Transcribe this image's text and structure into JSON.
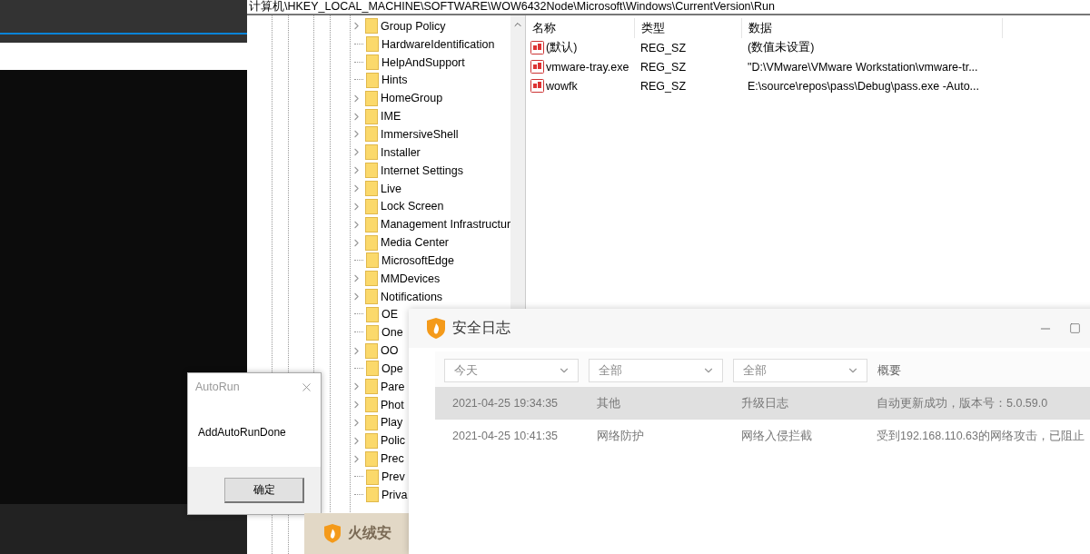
{
  "registry_editor": {
    "address": "计算机\\HKEY_LOCAL_MACHINE\\SOFTWARE\\WOW6432Node\\Microsoft\\Windows\\CurrentVersion\\Run",
    "tree": [
      {
        "label": "Group Policy",
        "has_children": true
      },
      {
        "label": "HardwareIdentification",
        "has_children": false
      },
      {
        "label": "HelpAndSupport",
        "has_children": false
      },
      {
        "label": "Hints",
        "has_children": false
      },
      {
        "label": "HomeGroup",
        "has_children": true
      },
      {
        "label": "IME",
        "has_children": true
      },
      {
        "label": "ImmersiveShell",
        "has_children": true
      },
      {
        "label": "Installer",
        "has_children": true
      },
      {
        "label": "Internet Settings",
        "has_children": true
      },
      {
        "label": "Live",
        "has_children": true
      },
      {
        "label": "Lock Screen",
        "has_children": true
      },
      {
        "label": "Management Infrastructur",
        "has_children": true
      },
      {
        "label": "Media Center",
        "has_children": true
      },
      {
        "label": "MicrosoftEdge",
        "has_children": false
      },
      {
        "label": "MMDevices",
        "has_children": true
      },
      {
        "label": "Notifications",
        "has_children": true
      },
      {
        "label": "OE",
        "has_children": false
      },
      {
        "label": "One",
        "has_children": false
      },
      {
        "label": "OO",
        "has_children": true
      },
      {
        "label": "Ope",
        "has_children": false
      },
      {
        "label": "Pare",
        "has_children": true
      },
      {
        "label": "Phot",
        "has_children": true
      },
      {
        "label": "Play",
        "has_children": true
      },
      {
        "label": "Polic",
        "has_children": true
      },
      {
        "label": "Prec",
        "has_children": true
      },
      {
        "label": "Prev",
        "has_children": false
      },
      {
        "label": "Priva",
        "has_children": false
      }
    ],
    "columns": [
      "名称",
      "类型",
      "数据"
    ],
    "values": [
      {
        "name": "(默认)",
        "type": "REG_SZ",
        "data": "(数值未设置)"
      },
      {
        "name": "vmware-tray.exe",
        "type": "REG_SZ",
        "data": "\"D:\\VMware\\VMware Workstation\\vmware-tr..."
      },
      {
        "name": "wowfk",
        "type": "REG_SZ",
        "data": "E:\\source\\repos\\pass\\Debug\\pass.exe -Auto..."
      }
    ]
  },
  "autorun_dialog": {
    "title": "AutoRun",
    "message": "AddAutoRunDone",
    "button": "确定"
  },
  "taskbar_popup": {
    "title": "火绒安"
  },
  "security_log": {
    "title": "安全日志",
    "filters": [
      "今天",
      "全部",
      "全部"
    ],
    "summary_header": "概要",
    "rows": [
      {
        "time": "2021-04-25 19:34:35",
        "category": "其他",
        "type": "升级日志",
        "summary": "自动更新成功，版本号：5.0.59.0",
        "selected": true
      },
      {
        "time": "2021-04-25 10:41:35",
        "category": "网络防护",
        "type": "网络入侵拦截",
        "summary": "受到192.168.110.63的网络攻击，已阻止",
        "selected": false
      }
    ]
  }
}
